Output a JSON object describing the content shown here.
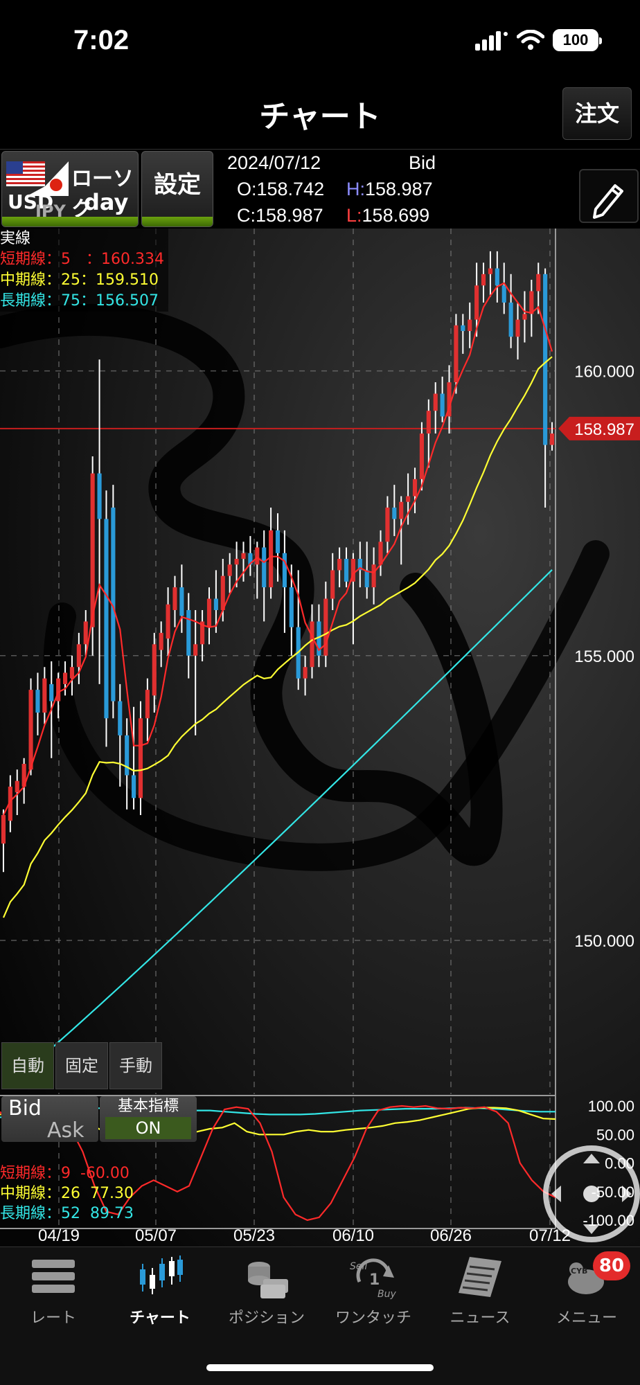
{
  "status_bar": {
    "time": "7:02",
    "battery": "100"
  },
  "header": {
    "title": "チャート",
    "order_button": "注文"
  },
  "toolbar": {
    "symbol_base": "USD",
    "symbol_quote": "JPY",
    "chart_type": "ローソク",
    "period": "day",
    "settings_button": "設定",
    "date": "2024/07/12",
    "price_type": "Bid",
    "open": "O:158.742",
    "high_label": "H:",
    "high": "158.987",
    "close": "C:158.987",
    "low_label": "L:",
    "low": "158.699"
  },
  "main_legend": {
    "title": "実線",
    "short": "短期線：5　：160.334",
    "mid": "中期線：25：159.510",
    "long": "長期線：75：156.507"
  },
  "y_axis": {
    "label_160": "160.000",
    "label_155": "155.000",
    "label_150": "150.000",
    "current_price": "158.987"
  },
  "mode_buttons": {
    "auto": "自動",
    "fixed": "固定",
    "manual": "手動"
  },
  "sub_panel": {
    "bid": "Bid",
    "ask": "Ask",
    "indicator_label": "基本指標",
    "indicator_state": "ON",
    "short": "短期線：9",
    "short_value": "-60.00",
    "mid": "中期線：26",
    "mid_value": "77.30",
    "long": "長期線：52",
    "long_value": "89.73",
    "axis": {
      "a100": "100.00",
      "a50": "50.00",
      "a0": "0.00",
      "am50": "-50.00",
      "am100": "-100.00"
    }
  },
  "x_axis": [
    "04/19",
    "05/07",
    "05/23",
    "06/10",
    "06/26",
    "07/12"
  ],
  "nav": {
    "rate": "レート",
    "chart": "チャート",
    "position": "ポジション",
    "one_touch": "ワンタッチ",
    "news": "ニュース",
    "menu": "メニュー",
    "menu_badge": "80"
  },
  "colors": {
    "up": "#e03030",
    "down": "#2a9ad8",
    "short_ma": "#ff2a2a",
    "mid_ma": "#ffff33",
    "long_ma": "#33e6e6"
  },
  "chart_data": {
    "type": "candlestick",
    "ylim": [
      147.3,
      162.5
    ],
    "yticks": [
      150,
      155,
      160
    ],
    "current_price": 158.987,
    "x_labels": [
      "04/19",
      "05/07",
      "05/23",
      "06/10",
      "06/26",
      "07/12"
    ],
    "candles": [
      {
        "o": 151.7,
        "h": 152.3,
        "l": 151.2,
        "c": 152.2
      },
      {
        "o": 152.1,
        "h": 152.9,
        "l": 151.9,
        "c": 152.7
      },
      {
        "o": 152.6,
        "h": 153.0,
        "l": 152.2,
        "c": 152.8
      },
      {
        "o": 152.7,
        "h": 153.2,
        "l": 152.4,
        "c": 153.1
      },
      {
        "o": 153.0,
        "h": 154.6,
        "l": 152.9,
        "c": 154.4
      },
      {
        "o": 154.4,
        "h": 154.7,
        "l": 153.6,
        "c": 154.0
      },
      {
        "o": 154.0,
        "h": 154.8,
        "l": 153.8,
        "c": 154.6
      },
      {
        "o": 154.5,
        "h": 154.9,
        "l": 153.2,
        "c": 154.2
      },
      {
        "o": 154.2,
        "h": 154.7,
        "l": 153.9,
        "c": 154.6
      },
      {
        "o": 154.5,
        "h": 154.9,
        "l": 154.3,
        "c": 154.7
      },
      {
        "o": 154.6,
        "h": 155.0,
        "l": 154.3,
        "c": 154.8
      },
      {
        "o": 154.8,
        "h": 155.4,
        "l": 154.5,
        "c": 155.2
      },
      {
        "o": 155.2,
        "h": 155.8,
        "l": 155.0,
        "c": 155.6
      },
      {
        "o": 155.5,
        "h": 158.5,
        "l": 155.0,
        "c": 158.2
      },
      {
        "o": 158.2,
        "h": 160.2,
        "l": 154.5,
        "c": 157.4
      },
      {
        "o": 157.4,
        "h": 157.9,
        "l": 153.4,
        "c": 153.9
      },
      {
        "o": 157.6,
        "h": 158.0,
        "l": 153.9,
        "c": 154.2
      },
      {
        "o": 154.2,
        "h": 154.5,
        "l": 152.7,
        "c": 153.6
      },
      {
        "o": 153.6,
        "h": 153.9,
        "l": 152.3,
        "c": 152.9
      },
      {
        "o": 152.9,
        "h": 154.1,
        "l": 152.3,
        "c": 152.5
      },
      {
        "o": 152.5,
        "h": 154.2,
        "l": 152.2,
        "c": 153.9
      },
      {
        "o": 153.9,
        "h": 154.6,
        "l": 153.5,
        "c": 154.4
      },
      {
        "o": 154.3,
        "h": 155.4,
        "l": 154.0,
        "c": 155.2
      },
      {
        "o": 155.1,
        "h": 155.6,
        "l": 154.8,
        "c": 155.4
      },
      {
        "o": 155.3,
        "h": 156.2,
        "l": 155.0,
        "c": 155.9
      },
      {
        "o": 155.8,
        "h": 156.4,
        "l": 155.5,
        "c": 156.2
      },
      {
        "o": 156.2,
        "h": 156.6,
        "l": 155.4,
        "c": 155.7
      },
      {
        "o": 155.8,
        "h": 156.1,
        "l": 154.6,
        "c": 155.0
      },
      {
        "o": 155.0,
        "h": 155.8,
        "l": 153.6,
        "c": 155.2
      },
      {
        "o": 155.2,
        "h": 155.8,
        "l": 154.9,
        "c": 155.6
      },
      {
        "o": 155.5,
        "h": 156.2,
        "l": 155.2,
        "c": 156.0
      },
      {
        "o": 156.0,
        "h": 156.5,
        "l": 155.4,
        "c": 155.8
      },
      {
        "o": 155.8,
        "h": 156.7,
        "l": 155.6,
        "c": 156.4
      },
      {
        "o": 156.4,
        "h": 156.8,
        "l": 156.1,
        "c": 156.6
      },
      {
        "o": 156.6,
        "h": 157.0,
        "l": 156.2,
        "c": 156.7
      },
      {
        "o": 156.7,
        "h": 157.0,
        "l": 156.3,
        "c": 156.8
      },
      {
        "o": 156.8,
        "h": 157.1,
        "l": 156.4,
        "c": 156.6
      },
      {
        "o": 156.6,
        "h": 157.0,
        "l": 156.0,
        "c": 156.9
      },
      {
        "o": 156.9,
        "h": 157.2,
        "l": 155.6,
        "c": 156.2
      },
      {
        "o": 156.2,
        "h": 157.6,
        "l": 156.0,
        "c": 157.2
      },
      {
        "o": 157.2,
        "h": 157.5,
        "l": 156.3,
        "c": 156.8
      },
      {
        "o": 156.8,
        "h": 157.2,
        "l": 155.4,
        "c": 156.2
      },
      {
        "o": 156.2,
        "h": 156.6,
        "l": 155.0,
        "c": 155.5
      },
      {
        "o": 155.5,
        "h": 156.5,
        "l": 154.4,
        "c": 154.6
      },
      {
        "o": 154.6,
        "h": 155.0,
        "l": 154.3,
        "c": 154.8
      },
      {
        "o": 154.8,
        "h": 155.9,
        "l": 154.6,
        "c": 155.6
      },
      {
        "o": 155.6,
        "h": 155.9,
        "l": 154.8,
        "c": 155.0
      },
      {
        "o": 155.0,
        "h": 156.3,
        "l": 154.8,
        "c": 156.0
      },
      {
        "o": 156.0,
        "h": 156.8,
        "l": 155.8,
        "c": 156.5
      },
      {
        "o": 156.5,
        "h": 156.9,
        "l": 156.2,
        "c": 156.7
      },
      {
        "o": 156.7,
        "h": 156.9,
        "l": 156.2,
        "c": 156.3
      },
      {
        "o": 156.3,
        "h": 156.8,
        "l": 155.2,
        "c": 156.7
      },
      {
        "o": 156.7,
        "h": 157.0,
        "l": 156.2,
        "c": 156.5
      },
      {
        "o": 156.5,
        "h": 157.0,
        "l": 156.0,
        "c": 156.2
      },
      {
        "o": 156.2,
        "h": 156.9,
        "l": 155.9,
        "c": 156.6
      },
      {
        "o": 156.6,
        "h": 157.2,
        "l": 156.4,
        "c": 157.0
      },
      {
        "o": 157.0,
        "h": 157.8,
        "l": 156.8,
        "c": 157.6
      },
      {
        "o": 157.6,
        "h": 158.0,
        "l": 157.1,
        "c": 157.4
      },
      {
        "o": 157.4,
        "h": 157.8,
        "l": 156.6,
        "c": 157.7
      },
      {
        "o": 157.7,
        "h": 158.2,
        "l": 157.3,
        "c": 157.8
      },
      {
        "o": 157.8,
        "h": 158.3,
        "l": 157.5,
        "c": 158.1
      },
      {
        "o": 158.1,
        "h": 159.1,
        "l": 157.9,
        "c": 158.9
      },
      {
        "o": 158.9,
        "h": 159.5,
        "l": 158.3,
        "c": 159.3
      },
      {
        "o": 159.3,
        "h": 159.8,
        "l": 158.9,
        "c": 159.6
      },
      {
        "o": 159.6,
        "h": 159.9,
        "l": 159.1,
        "c": 159.2
      },
      {
        "o": 159.2,
        "h": 160.1,
        "l": 158.9,
        "c": 159.8
      },
      {
        "o": 159.8,
        "h": 161.0,
        "l": 159.6,
        "c": 160.8
      },
      {
        "o": 160.8,
        "h": 161.0,
        "l": 160.3,
        "c": 160.7
      },
      {
        "o": 160.7,
        "h": 161.2,
        "l": 160.4,
        "c": 160.9
      },
      {
        "o": 160.9,
        "h": 161.9,
        "l": 160.6,
        "c": 161.5
      },
      {
        "o": 161.5,
        "h": 161.9,
        "l": 161.2,
        "c": 161.7
      },
      {
        "o": 161.7,
        "h": 162.1,
        "l": 161.3,
        "c": 161.8
      },
      {
        "o": 161.8,
        "h": 162.1,
        "l": 161.2,
        "c": 161.5
      },
      {
        "o": 161.5,
        "h": 161.9,
        "l": 161.0,
        "c": 161.2
      },
      {
        "o": 161.2,
        "h": 161.7,
        "l": 160.4,
        "c": 160.6
      },
      {
        "o": 160.6,
        "h": 161.2,
        "l": 160.2,
        "c": 160.9
      },
      {
        "o": 160.9,
        "h": 161.4,
        "l": 160.5,
        "c": 161.0
      },
      {
        "o": 161.0,
        "h": 161.6,
        "l": 160.6,
        "c": 161.4
      },
      {
        "o": 161.4,
        "h": 161.9,
        "l": 161.0,
        "c": 161.7
      },
      {
        "o": 161.7,
        "h": 161.8,
        "l": 157.6,
        "c": 158.7
      },
      {
        "o": 158.7,
        "h": 159.1,
        "l": 158.6,
        "c": 158.9
      }
    ],
    "ma_short_period": 5,
    "ma_mid_period": 25,
    "ma_long_period": 75,
    "ma_long_end": 156.507,
    "ma_mid_end": 159.51
  }
}
